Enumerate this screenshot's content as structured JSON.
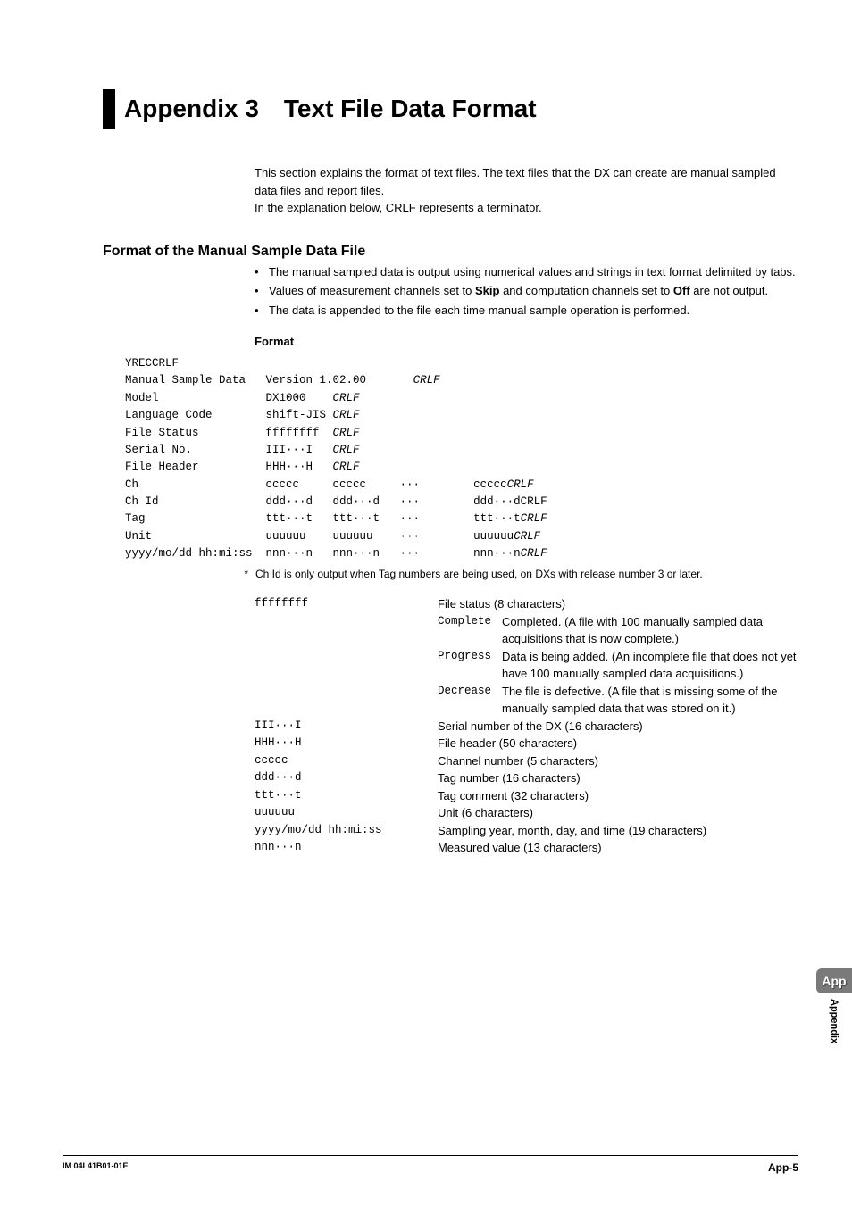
{
  "title": "Appendix 3 Text File Data Format",
  "intro_lines": [
    "This section explains the format of text files. The text files that the DX can create are manual sampled data files and report files.",
    "In the explanation below, CRLF represents a terminator."
  ],
  "section_heading": "Format of the Manual Sample Data File",
  "bullets": [
    "The manual sampled data is output using numerical values and strings in text format delimited by tabs.",
    "Values of measurement channels set to <b>Skip</b> and computation channels set to <b>Off</b> are not output.",
    "The data is appended to the file each time manual sample operation is performed."
  ],
  "subheading": "Format",
  "format_lines": [
    "YRECCRLF",
    "Manual Sample Data   Version 1.02.00       <i>CRLF</i>",
    "Model                DX1000    <i>CRLF</i>",
    "Language Code        shift-JIS <i>CRLF</i>",
    "File Status          ffffffff  <i>CRLF</i>",
    "Serial No.           III···I   <i>CRLF</i>",
    "File Header          HHH···H   <i>CRLF</i>",
    "Ch                   ccccc     ccccc     ···        ccccc<i>CRLF</i>",
    "Ch Id                ddd···d   ddd···d   ···        ddd···dCRLF",
    "Tag                  ttt···t   ttt···t   ···        ttt···t<i>CRLF</i>",
    "Unit                 uuuuuu    uuuuuu    ···        uuuuuu<i>CRLF</i>",
    "yyyy/mo/dd hh:mi:ss  nnn···n   nnn···n   ···        nnn···n<i>CRLF</i>"
  ],
  "footnote_mark": "*",
  "footnote_text": "Ch Id is only output when Tag numbers are being used, on DXs with release number 3 or later.",
  "desc": {
    "file_status": {
      "key": "ffffffff",
      "label": "File status (8 characters)",
      "subs": [
        {
          "k": "Complete",
          "v": "Completed. (A file with 100 manually sampled data acquisitions that is now complete.)"
        },
        {
          "k": "Progress",
          "v": "Data is being added. (An incomplete file that does not yet have 100 manually sampled data acquisitions.)"
        },
        {
          "k": "Decrease",
          "v": "The file is defective. (A file that is missing some of the manually sampled data that was stored on it.)"
        }
      ]
    },
    "rows": [
      {
        "k": "III···I",
        "v": "Serial number of the DX (16 characters)"
      },
      {
        "k": "HHH···H",
        "v": "File header (50 characters)"
      },
      {
        "k": "ccccc",
        "v": "Channel number (5 characters)"
      },
      {
        "k": "ddd···d",
        "v": "Tag number (16 characters)"
      },
      {
        "k": "ttt···t",
        "v": "Tag comment (32 characters)"
      },
      {
        "k": "uuuuuu",
        "v": "Unit (6 characters)"
      },
      {
        "k": "yyyy/mo/dd hh:mi:ss",
        "v": "Sampling year, month, day, and time (19 characters)"
      },
      {
        "k": "nnn···n",
        "v": "Measured value (13 characters)"
      }
    ]
  },
  "side_tab": {
    "app": "App",
    "appendix": "Appendix"
  },
  "footer": {
    "left": "IM 04L41B01-01E",
    "right": "App-5"
  }
}
